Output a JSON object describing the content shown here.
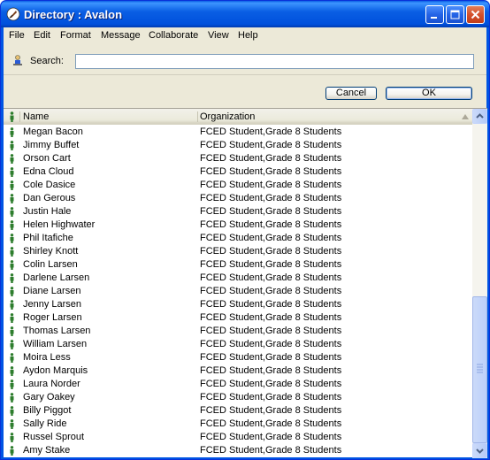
{
  "window": {
    "title": "Directory : Avalon",
    "icon": "avalon-feather-icon",
    "title_color": "#0054e3"
  },
  "menu": [
    "File",
    "Edit",
    "Format",
    "Message",
    "Collaborate",
    "View",
    "Help"
  ],
  "search": {
    "label": "Search:",
    "value": "",
    "icon": "search-person-icon"
  },
  "buttons": {
    "cancel": "Cancel",
    "ok": "OK"
  },
  "list": {
    "columns": [
      "Name",
      "Organization"
    ],
    "sort_column": "Organization",
    "sort_direction": "ascending",
    "row_icon": "person-icon",
    "rows": [
      {
        "name": "Megan Bacon",
        "org": "FCED Student,Grade 8 Students"
      },
      {
        "name": "Jimmy Buffet",
        "org": "FCED Student,Grade 8 Students"
      },
      {
        "name": "Orson Cart",
        "org": "FCED Student,Grade 8 Students"
      },
      {
        "name": "Edna Cloud",
        "org": "FCED Student,Grade 8 Students"
      },
      {
        "name": "Cole Dasice",
        "org": "FCED Student,Grade 8 Students"
      },
      {
        "name": "Dan Gerous",
        "org": "FCED Student,Grade 8 Students"
      },
      {
        "name": "Justin Hale",
        "org": "FCED Student,Grade 8 Students"
      },
      {
        "name": "Helen Highwater",
        "org": "FCED Student,Grade 8 Students"
      },
      {
        "name": "Phil Itafiche",
        "org": "FCED Student,Grade 8 Students"
      },
      {
        "name": "Shirley Knott",
        "org": "FCED Student,Grade 8 Students"
      },
      {
        "name": "Colin Larsen",
        "org": "FCED Student,Grade 8 Students"
      },
      {
        "name": "Darlene Larsen",
        "org": "FCED Student,Grade 8 Students"
      },
      {
        "name": "Diane Larsen",
        "org": "FCED Student,Grade 8 Students"
      },
      {
        "name": "Jenny Larsen",
        "org": "FCED Student,Grade 8 Students"
      },
      {
        "name": "Roger Larsen",
        "org": "FCED Student,Grade 8 Students"
      },
      {
        "name": "Thomas Larsen",
        "org": "FCED Student,Grade 8 Students"
      },
      {
        "name": "William Larsen",
        "org": "FCED Student,Grade 8 Students"
      },
      {
        "name": "Moira Less",
        "org": "FCED Student,Grade 8 Students"
      },
      {
        "name": "Aydon Marquis",
        "org": "FCED Student,Grade 8 Students"
      },
      {
        "name": "Laura Norder",
        "org": "FCED Student,Grade 8 Students"
      },
      {
        "name": "Gary Oakey",
        "org": "FCED Student,Grade 8 Students"
      },
      {
        "name": "Billy Piggot",
        "org": "FCED Student,Grade 8 Students"
      },
      {
        "name": "Sally Ride",
        "org": "FCED Student,Grade 8 Students"
      },
      {
        "name": "Russel Sprout",
        "org": "FCED Student,Grade 8 Students"
      },
      {
        "name": "Amy Stake",
        "org": "FCED Student,Grade 8 Students"
      }
    ]
  }
}
